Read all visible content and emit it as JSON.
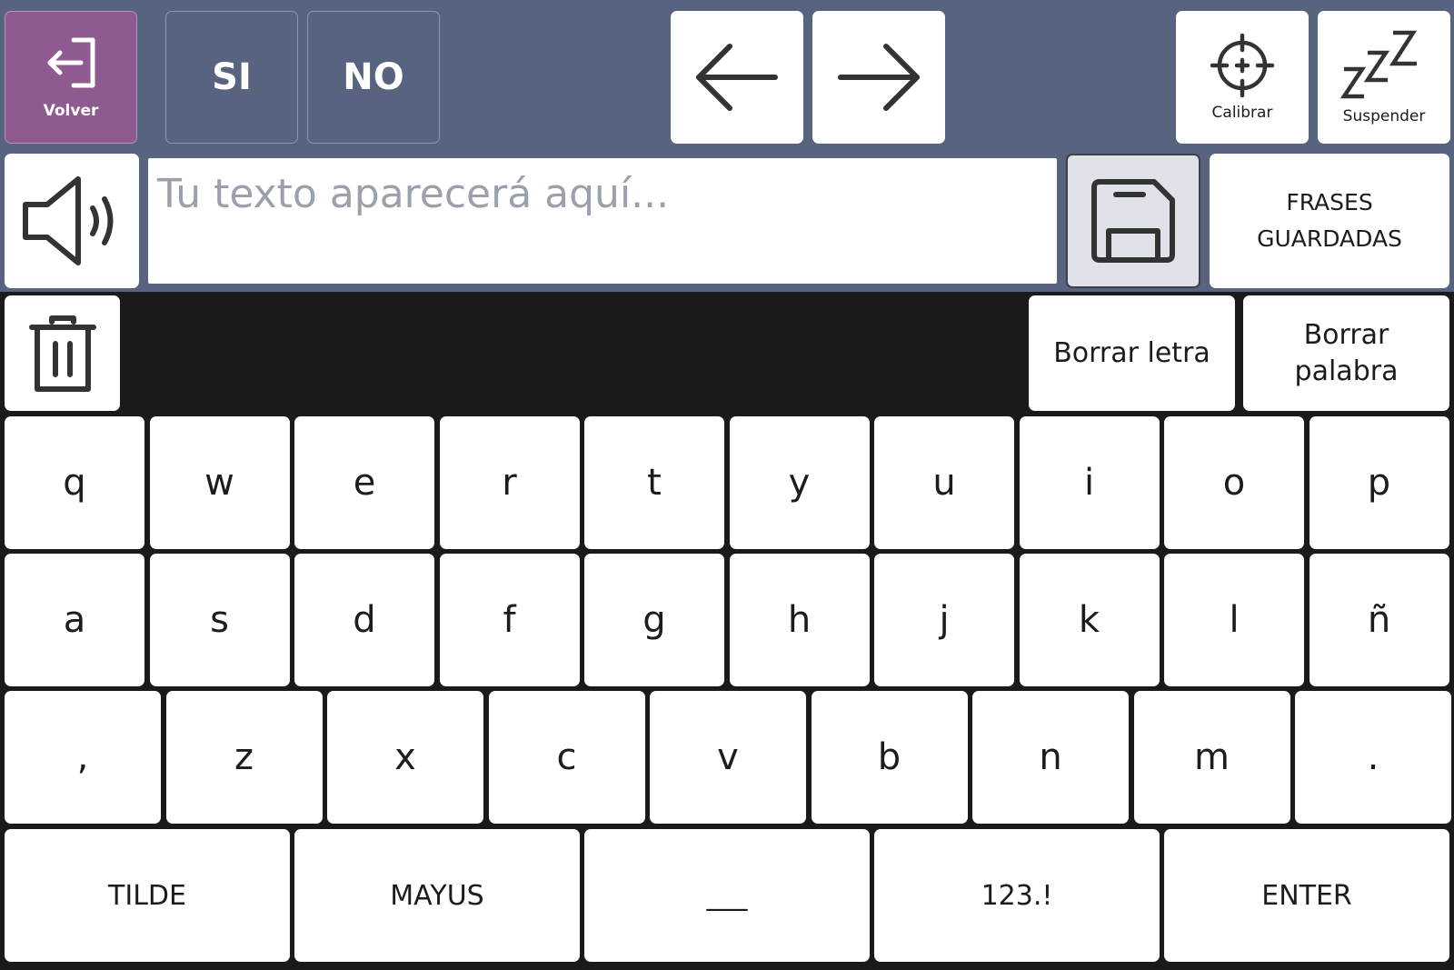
{
  "top_bar": {
    "volver_label": "Volver",
    "si_label": "SI",
    "no_label": "NO",
    "calibrar_label": "Calibrar",
    "suspender_label": "Suspender",
    "volver_color": "#8f5a90",
    "bar_color": "#586380"
  },
  "text_area": {
    "placeholder": "Tu texto aparecerá aquí...",
    "value": ""
  },
  "saved_phrases": {
    "line1": "FRASES",
    "line2": "GUARDADAS"
  },
  "delete": {
    "letter_label": "Borrar letra",
    "word_line1": "Borrar",
    "word_line2": "palabra"
  },
  "keyboard": {
    "row1": [
      "q",
      "w",
      "e",
      "r",
      "t",
      "y",
      "u",
      "i",
      "o",
      "p"
    ],
    "row2": [
      "a",
      "s",
      "d",
      "f",
      "g",
      "h",
      "j",
      "k",
      "l",
      "ñ"
    ],
    "row3": [
      ",",
      "z",
      "x",
      "c",
      "v",
      "b",
      "n",
      "m",
      "."
    ],
    "row4": [
      "TILDE",
      "MAYUS",
      "___",
      "123.!",
      "ENTER"
    ]
  }
}
